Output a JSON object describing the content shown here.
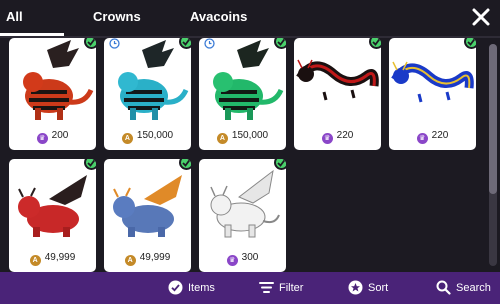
{
  "tabs": {
    "all": "All",
    "crowns": "Crowns",
    "avacoins": "Avacoins"
  },
  "colors": {
    "accent": "#4a2378",
    "owned_check": "#49d16b",
    "crown_coin": "#8a46c8",
    "avacoin": "#c48a28"
  },
  "items": [
    {
      "price": "200",
      "currency": "crown-icon",
      "owned": true,
      "limited": false,
      "theme": "red-black striped dragon"
    },
    {
      "price": "150,000",
      "currency": "avacoin-icon",
      "owned": true,
      "limited": true,
      "theme": "teal-black striped dragon"
    },
    {
      "price": "150,000",
      "currency": "avacoin-icon",
      "owned": true,
      "limited": true,
      "theme": "green-black striped dragon"
    },
    {
      "price": "220",
      "currency": "crown-icon",
      "owned": true,
      "limited": false,
      "theme": "red-black serpent dragon"
    },
    {
      "price": "220",
      "currency": "crown-icon",
      "owned": true,
      "limited": false,
      "theme": "blue-gold serpent dragon"
    },
    {
      "price": "49,999",
      "currency": "avacoin-icon",
      "owned": true,
      "limited": false,
      "theme": "red dragon"
    },
    {
      "price": "49,999",
      "currency": "avacoin-icon",
      "owned": true,
      "limited": false,
      "theme": "blue-orange dragon"
    },
    {
      "price": "300",
      "currency": "crown-icon",
      "owned": true,
      "limited": false,
      "theme": "white dragon"
    }
  ],
  "toolbar": {
    "items": "Items",
    "filter": "Filter",
    "sort": "Sort",
    "search": "Search"
  }
}
